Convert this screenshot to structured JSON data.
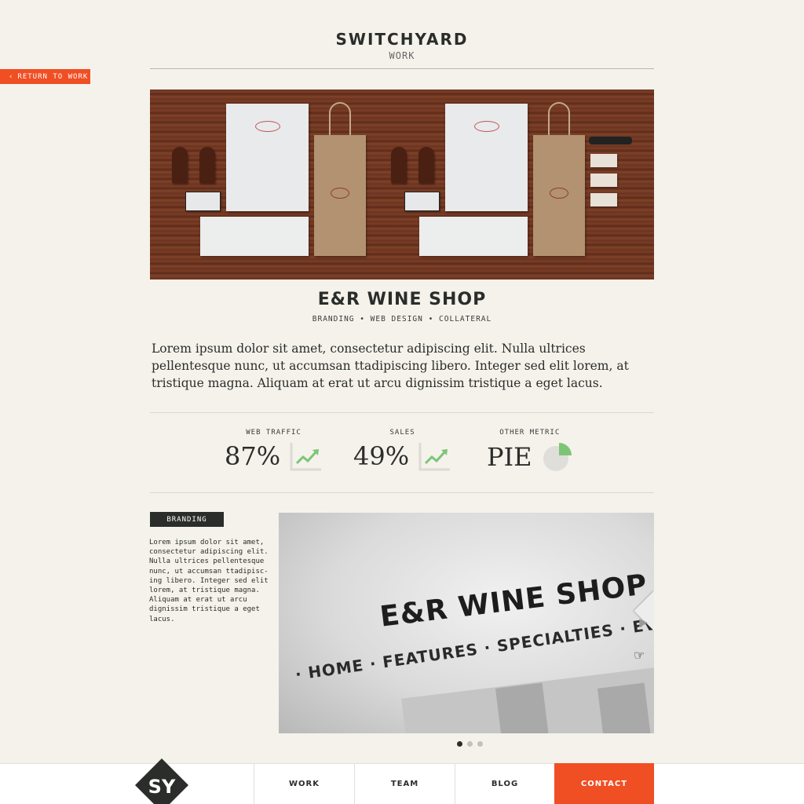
{
  "header": {
    "brand": "SWITCHYARD",
    "section": "WORK"
  },
  "return_button": {
    "icon": "chevron-left-icon",
    "label": "RETURN TO WORK"
  },
  "hero": {
    "card_text": "E&R WINE SHOP"
  },
  "project": {
    "title": "E&R WINE SHOP",
    "tags": "BRANDING • WEB DESIGN • COLLATERAL",
    "intro": "Lorem ipsum dolor sit amet, consectetur adipiscing elit. Nulla ultrices pellentesque nunc, ut accumsan ttadipiscing libero. Integer sed elit lorem, at tristique magna. Aliquam at erat ut arcu dignissim tristique a eget lacus."
  },
  "metrics": [
    {
      "label": "WEB TRAFFIC",
      "value": "87%",
      "icon": "trend-up-icon"
    },
    {
      "label": "SALES",
      "value": "49%",
      "icon": "trend-up-icon"
    },
    {
      "label": "OTHER METRIC",
      "value": "PIE",
      "icon": "pie-chart-icon"
    }
  ],
  "branding": {
    "badge": "BRANDING",
    "text": "Lorem ipsum dolor sit amet, consectetur adipiscing elit. Nulla ultrices pellentesque nunc, ut accumsan ttadipisc-ing libero. Integer sed elit lorem, at tristique magna. Aliquam at erat ut arcu dignissim tristique a eget lacus."
  },
  "gallery": {
    "title": "E&R WINE SHOP",
    "nav": "· HOME · FEATURES · SPECIALTIES · EVENTS · ABOUT",
    "active_slide": 1,
    "slide_count": 3
  },
  "footer": {
    "logo": "SY",
    "nav": [
      "WORK",
      "TEAM",
      "BLOG",
      "CONTACT"
    ]
  },
  "colors": {
    "accent": "#f04e23",
    "dark": "#2b2d2a",
    "background": "#f5f2ec",
    "chart_green": "#7cc576"
  }
}
